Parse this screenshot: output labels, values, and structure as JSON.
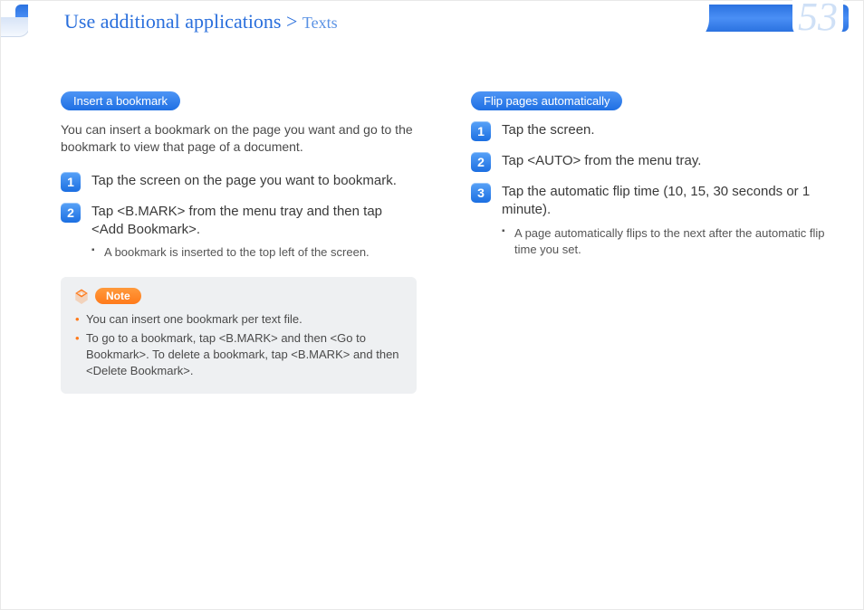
{
  "header": {
    "breadcrumb_main": "Use additional applications > ",
    "breadcrumb_sub": "Texts",
    "page_number": "53"
  },
  "left": {
    "pill": "Insert a bookmark",
    "intro": "You can insert a bookmark on the page you want and go to the bookmark to view that page of a document.",
    "steps": [
      {
        "n": "1",
        "text": "Tap the screen on the page you want to bookmark."
      },
      {
        "n": "2",
        "text": "Tap <B.MARK> from the menu tray and then tap <Add Bookmark>.",
        "sub": [
          "A bookmark is inserted to the top left of the screen."
        ]
      }
    ],
    "note": {
      "label": "Note",
      "items": [
        "You can insert one bookmark per text file.",
        "To go to a bookmark, tap <B.MARK> and then <Go to Bookmark>. To delete a bookmark, tap <B.MARK> and then <Delete Bookmark>."
      ]
    }
  },
  "right": {
    "pill": "Flip pages automatically",
    "steps": [
      {
        "n": "1",
        "text": "Tap the screen."
      },
      {
        "n": "2",
        "text": "Tap <AUTO> from the menu tray."
      },
      {
        "n": "3",
        "text": "Tap the automatic flip time (10, 15, 30 seconds or 1 minute).",
        "sub": [
          "A page automatically flips to the next after the automatic flip time you set."
        ]
      }
    ]
  }
}
